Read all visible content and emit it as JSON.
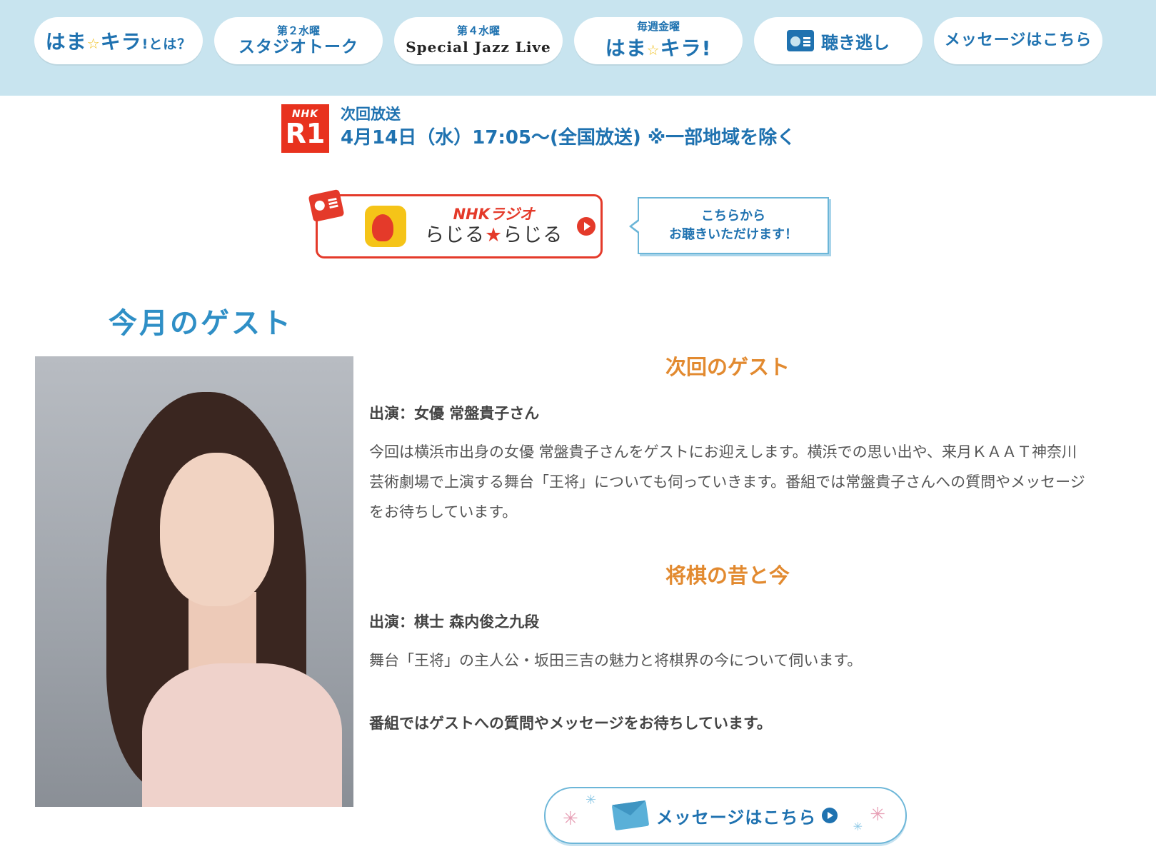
{
  "nav": {
    "items": [
      {
        "main": "はま",
        "star": "☆",
        "main2": "キラ",
        "suffix": "!とは？"
      },
      {
        "sub": "第２水曜",
        "main": "スタジオトーク"
      },
      {
        "sub": "第４水曜",
        "main": "Special Jazz Live"
      },
      {
        "sub": "毎週金曜",
        "main": "はま",
        "star": "☆",
        "main2": "キラ!"
      },
      {
        "main": "聴き逃し"
      },
      {
        "main": "メッセージはこちら"
      }
    ]
  },
  "broadcast": {
    "badge_top": "NHK",
    "badge_main": "R1",
    "label": "次回放送",
    "date": "4月14日（水）17:05～(全国放送) ※一部地域を除く"
  },
  "radiru": {
    "nhk": "NHKラジオ",
    "name_a": "らじる",
    "star": "★",
    "name_b": "らじる",
    "callout_line1": "こちらから",
    "callout_line2": "お聴きいただけます！"
  },
  "guest_section": {
    "heading": "今月のゲスト",
    "topics": [
      {
        "title": "次回のゲスト",
        "performer": "出演：女優 常盤貴子さん",
        "description": "今回は横浜市出身の女優 常盤貴子さんをゲストにお迎えします。横浜での思い出や、来月ＫＡＡＴ神奈川芸術劇場で上演する舞台「王将」についても伺っていきます。番組では常盤貴子さんへの質問やメッセージをお待ちしています。"
      },
      {
        "title": "将棋の昔と今",
        "performer": "出演：棋士 森内俊之九段",
        "description": "舞台「王将」の主人公・坂田三吉の魅力と将棋界の今について伺います。"
      }
    ],
    "closing": "番組ではゲストへの質問やメッセージをお待ちしています。",
    "message_button": "メッセージはこちら"
  },
  "colors": {
    "header_bg": "#c8e4ef",
    "brand_blue": "#1f72b0",
    "nhk_red": "#e8321e",
    "topic_orange": "#e28a30"
  },
  "icons": [
    "radio-icon",
    "play-icon",
    "envelope-icon",
    "radiru-app-icon"
  ]
}
